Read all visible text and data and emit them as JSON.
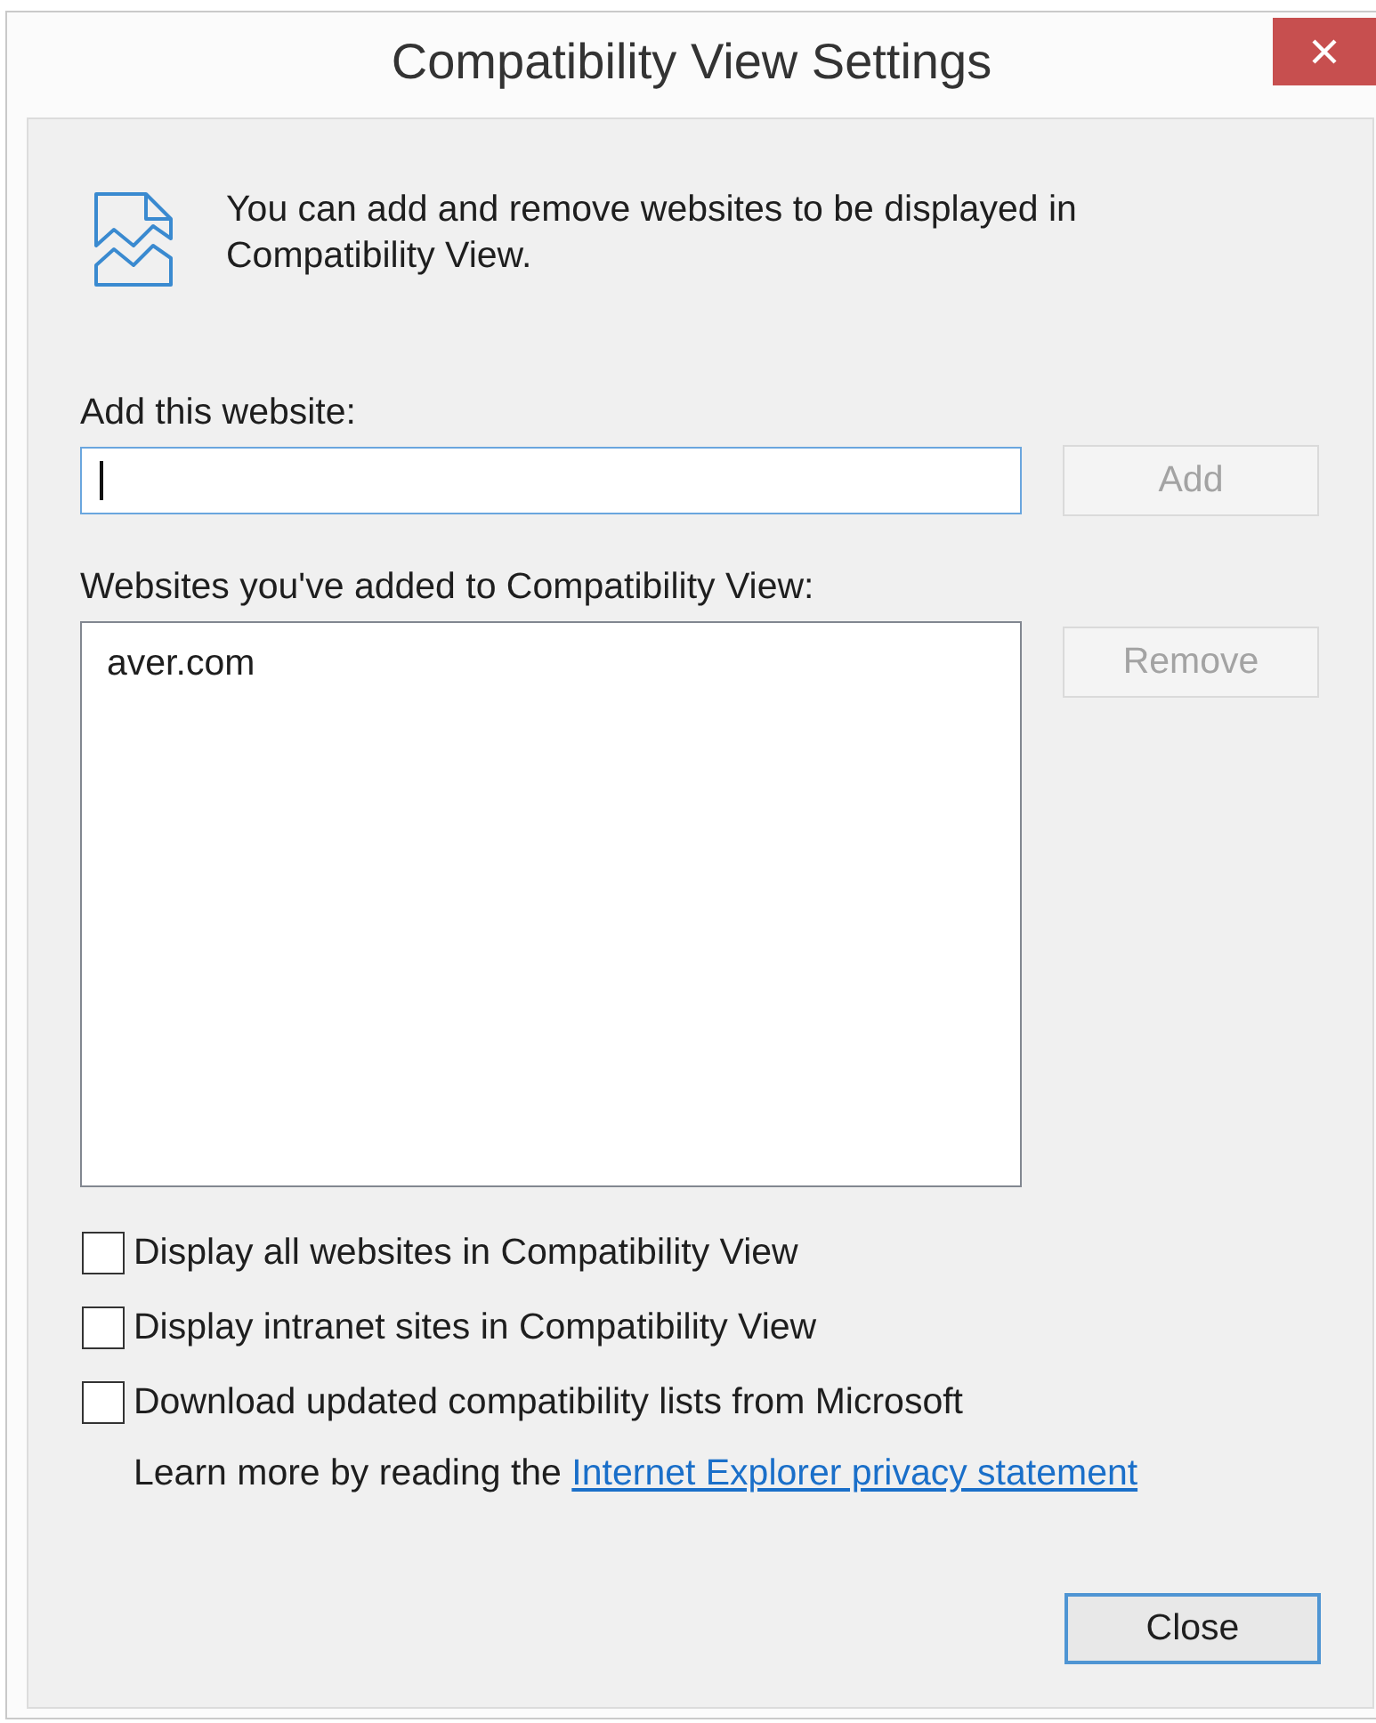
{
  "window": {
    "title": "Compatibility View Settings"
  },
  "intro": {
    "text": "You can add and remove websites to be displayed in Compatibility View."
  },
  "add_website": {
    "label": "Add this website:",
    "focused": true,
    "button": {
      "label": "Add",
      "disabled": true
    }
  },
  "websites_list": {
    "label": "Websites you've added to Compatibility View:",
    "items": [
      {
        "text": "aver.com",
        "selected": false
      }
    ],
    "remove_button": {
      "label": "Remove",
      "disabled": true
    }
  },
  "options": [
    {
      "label": "Display all websites in Compatibility View",
      "checked": false
    },
    {
      "label": "Display intranet sites in Compatibility View",
      "checked": false
    },
    {
      "label": "Download updated compatibility lists from Microsoft",
      "checked": false
    }
  ],
  "privacy_note": {
    "text": "Learn more by reading the",
    "link": "Internet Explorer privacy statement"
  },
  "buttons": [
    {
      "label": "Close",
      "default": true
    }
  ]
}
